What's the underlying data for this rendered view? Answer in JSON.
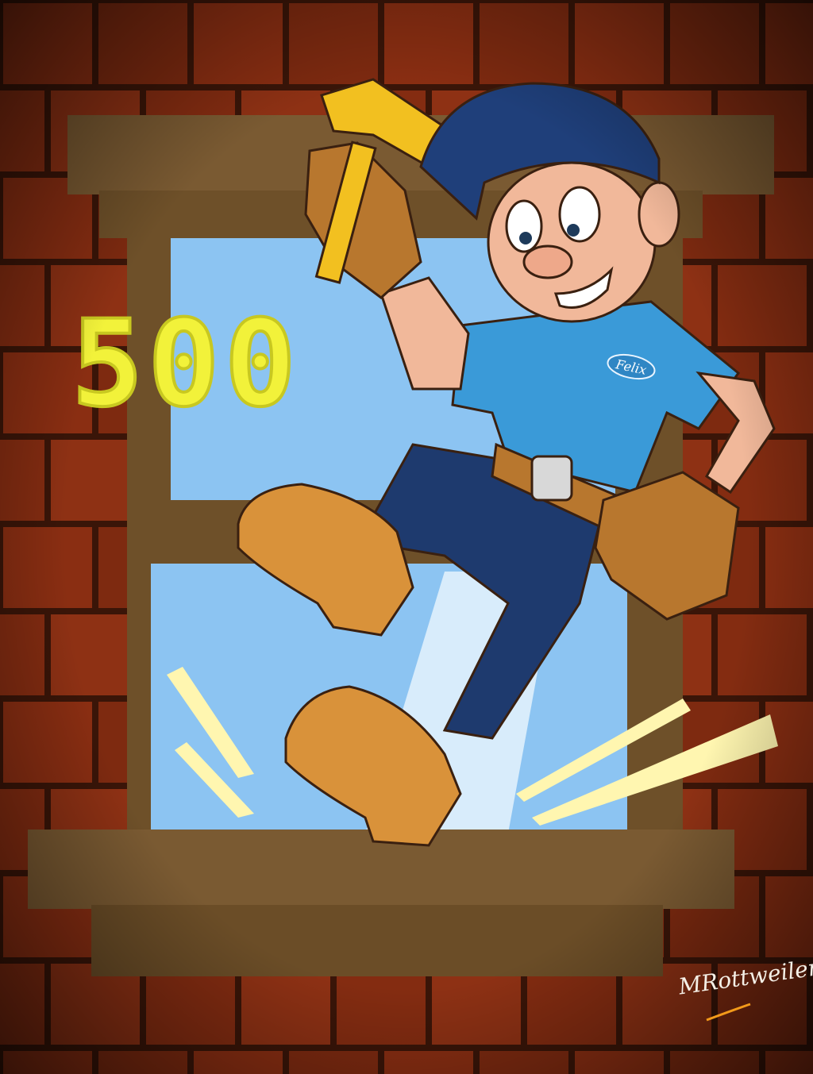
{
  "artwork": {
    "score": "500",
    "shirt_logo": "Felix",
    "signature": "MRottweiler"
  },
  "colors": {
    "brick": "#8a2e12",
    "mortar": "#3a1508",
    "window_frame": "#7a5a32",
    "sky": "#8cc4f2",
    "score": "#f2f23a",
    "shirt": "#3a9ad8",
    "jeans": "#1e3a6e",
    "cap": "#1f3f7a",
    "glove": "#b8772e",
    "boot": "#d9923a",
    "hammer": "#f2c020"
  }
}
